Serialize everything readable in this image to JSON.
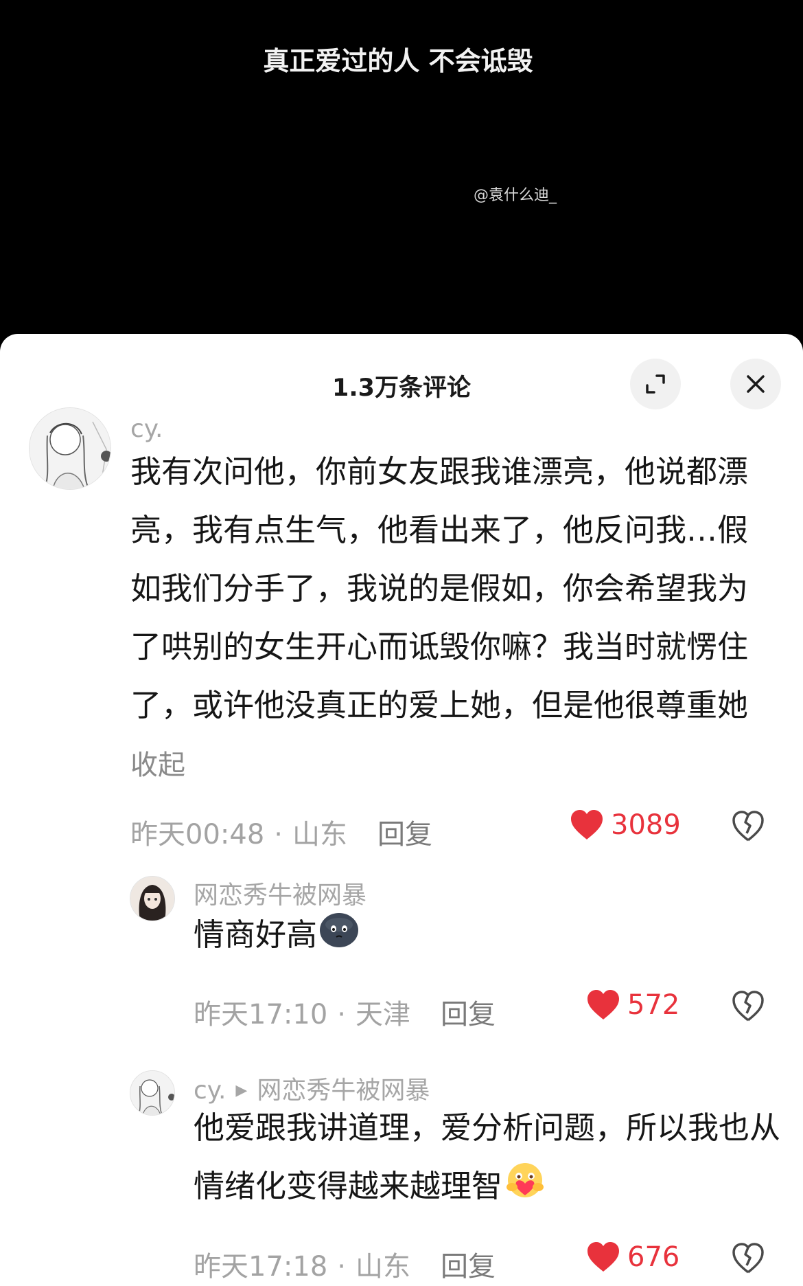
{
  "video": {
    "caption": "真正爱过的人 不会诋毁",
    "watermark": "@袁什么迪_"
  },
  "comments_panel": {
    "title": "1.3万条评论",
    "expand_icon": "expand-icon",
    "close_icon": "close-icon",
    "comments": [
      {
        "username": "cy.",
        "text": "我有次问他，你前女友跟我谁漂亮，他说都漂亮，我有点生气，他看出来了，他反问我…假如我们分手了，我说的是假如，你会希望我为了哄别的女生开心而诋毁你嘛？我当时就愣住了，或许他没真正的爱上她，但是他很尊重她",
        "collapse_label": "收起",
        "time": "昨天00:48",
        "location": "山东",
        "reply_label": "回复",
        "likes": "3089"
      },
      {
        "username": "网恋秀牛被网暴",
        "text": "情商好高",
        "emoji": "pouting-face-emoji",
        "time": "昨天17:10",
        "location": "天津",
        "reply_label": "回复",
        "likes": "572"
      },
      {
        "username": "cy.",
        "reply_to": "网恋秀牛被网暴",
        "text": "他爱跟我讲道理，爱分析问题，所以我也从情绪化变得越来越理智",
        "emoji": "heart-hug-emoji",
        "time": "昨天17:18",
        "location": "山东",
        "reply_label": "回复",
        "likes": "676"
      }
    ]
  },
  "colors": {
    "like_red": "#e8323c",
    "meta_gray": "#a3a3a3",
    "text_dark": "#161616"
  }
}
